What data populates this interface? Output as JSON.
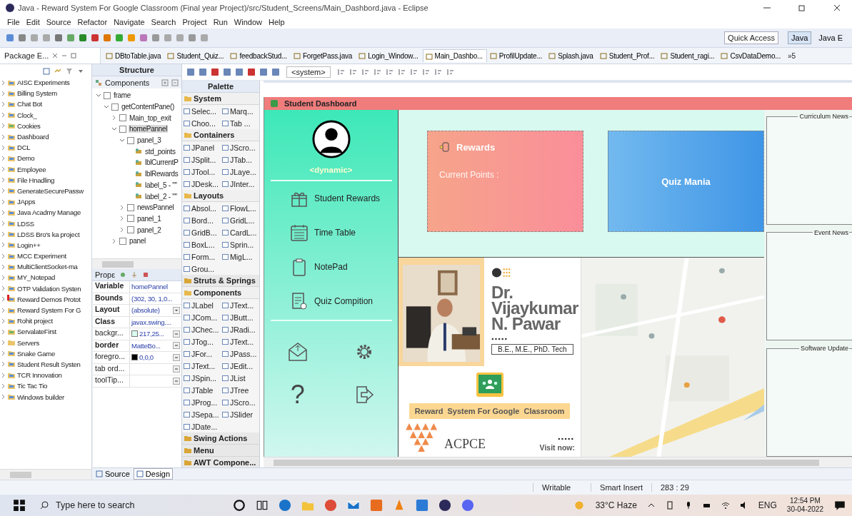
{
  "window": {
    "title": "Java - Reward System For Google Classroom (Final year Project)/src/Student_Screens/Main_Dashbord.java - Eclipse"
  },
  "menu": [
    "File",
    "Edit",
    "Source",
    "Refactor",
    "Navigate",
    "Search",
    "Project",
    "Run",
    "Window",
    "Help"
  ],
  "toolbar": {
    "quick_access": "Quick Access",
    "perspectives": [
      {
        "label": "Java",
        "selected": true
      },
      {
        "label": "Java E",
        "selected": false
      }
    ]
  },
  "package_explorer": {
    "tab": "Package E...",
    "items": [
      {
        "name": "AISC Experiments",
        "kind": "project"
      },
      {
        "name": "Billing System",
        "kind": "project"
      },
      {
        "name": "Chat Bot",
        "kind": "project"
      },
      {
        "name": "Clock_",
        "kind": "project"
      },
      {
        "name": "Cookies",
        "kind": "web"
      },
      {
        "name": "Dashboard",
        "kind": "project"
      },
      {
        "name": "DCL",
        "kind": "project"
      },
      {
        "name": "Demo",
        "kind": "project"
      },
      {
        "name": "Employee",
        "kind": "project"
      },
      {
        "name": "File Hnadling",
        "kind": "project"
      },
      {
        "name": "GenerateSecurePassw",
        "kind": "project"
      },
      {
        "name": "JApps",
        "kind": "project"
      },
      {
        "name": "Java Acadmy Manage",
        "kind": "project"
      },
      {
        "name": "LDSS",
        "kind": "project"
      },
      {
        "name": "LDSS Bro's ka project",
        "kind": "project"
      },
      {
        "name": "Login++",
        "kind": "project"
      },
      {
        "name": "MCC Experiment",
        "kind": "project"
      },
      {
        "name": "MultiClientSocket-ma",
        "kind": "project"
      },
      {
        "name": "MY_Notepad",
        "kind": "project"
      },
      {
        "name": "OTP Validation Systen",
        "kind": "project"
      },
      {
        "name": "Reward Demos Protot",
        "kind": "error"
      },
      {
        "name": "Reward System For G",
        "kind": "project"
      },
      {
        "name": "Rohit project",
        "kind": "project"
      },
      {
        "name": "ServalateFirst",
        "kind": "web"
      },
      {
        "name": "Servers",
        "kind": "folder"
      },
      {
        "name": "Snake Game",
        "kind": "project"
      },
      {
        "name": "Student Result Systen",
        "kind": "project"
      },
      {
        "name": "TCR Innovation",
        "kind": "project"
      },
      {
        "name": "Tic Tac Tio",
        "kind": "project"
      },
      {
        "name": "Windows builder",
        "kind": "project"
      }
    ]
  },
  "editor_tabs": [
    {
      "label": "DBtoTable.java",
      "selected": false
    },
    {
      "label": "Student_Quiz...",
      "selected": false
    },
    {
      "label": "feedbackStud...",
      "selected": false
    },
    {
      "label": "ForgetPass.java",
      "selected": false
    },
    {
      "label": "Login_Window...",
      "selected": false
    },
    {
      "label": "Main_Dashbo...",
      "selected": true
    },
    {
      "label": "ProfilUpdate...",
      "selected": false
    },
    {
      "label": "Splash.java",
      "selected": false
    },
    {
      "label": "Student_Prof...",
      "selected": false
    },
    {
      "label": "Student_ragi...",
      "selected": false
    },
    {
      "label": "CsvDataDemo...",
      "selected": false
    }
  ],
  "editor_tabs_overflow": "»5",
  "structure": {
    "title": "Structure",
    "components_label": "Components",
    "tree": [
      {
        "label": "frame",
        "kind": "container",
        "expanded": true,
        "selected": false,
        "children": [
          {
            "label": "getContentPane()",
            "kind": "container",
            "expanded": true,
            "selected": false,
            "children": [
              {
                "label": "Main_top_exit",
                "kind": "container",
                "expanded": false,
                "selected": false
              },
              {
                "label": "homePannel",
                "kind": "container",
                "expanded": true,
                "selected": true,
                "children": [
                  {
                    "label": "panel_3",
                    "kind": "container",
                    "expanded": true,
                    "selected": false,
                    "children": [
                      {
                        "label": "std_points",
                        "kind": "label",
                        "selected": false
                      },
                      {
                        "label": "lblCurrentP",
                        "kind": "label",
                        "selected": false
                      },
                      {
                        "label": "lblRewards",
                        "kind": "label",
                        "selected": false
                      },
                      {
                        "label": "label_5 - \"\"",
                        "kind": "label",
                        "selected": false
                      },
                      {
                        "label": "label_2 - \"\"",
                        "kind": "label",
                        "selected": false
                      }
                    ]
                  },
                  {
                    "label": "newsPannel",
                    "kind": "container",
                    "expanded": false,
                    "selected": false
                  },
                  {
                    "label": "panel_1",
                    "kind": "container",
                    "expanded": false,
                    "selected": false
                  },
                  {
                    "label": "panel_2",
                    "kind": "container",
                    "expanded": false,
                    "selected": false
                  }
                ]
              },
              {
                "label": "panel",
                "kind": "container",
                "expanded": false,
                "selected": false
              }
            ]
          }
        ]
      }
    ]
  },
  "properties": {
    "title": "Propε",
    "rows": [
      {
        "name": "Variable",
        "value": "homePannel",
        "bold": true,
        "kind": "plain"
      },
      {
        "name": "Bounds",
        "value": "(302, 30, 1,0...",
        "bold": true,
        "kind": "expand"
      },
      {
        "name": "Layout",
        "value": "(absolute)",
        "bold": true,
        "kind": "dropdown"
      },
      {
        "name": "Class",
        "value": "javax.swing....",
        "bold": true,
        "kind": "plain"
      },
      {
        "name": "backgr...",
        "value": "217,25...",
        "bold": false,
        "kind": "button",
        "color": "#d9fbf0"
      },
      {
        "name": "border",
        "value": "MatteBo...",
        "bold": true,
        "kind": "button"
      },
      {
        "name": "foregro...",
        "value": "0,0,0",
        "bold": false,
        "kind": "button",
        "color": "#000000"
      },
      {
        "name": "tab ord...",
        "bold": false,
        "kind": "button"
      },
      {
        "name": "toolTip...",
        "bold": false,
        "kind": "button"
      }
    ]
  },
  "editor_toolbar": {
    "system": "<system>"
  },
  "palette": {
    "title": "Palette",
    "groups": [
      {
        "name": "System",
        "expanded": true,
        "items": [
          "Selec...",
          "Marq...",
          "Choo...",
          "Tab ..."
        ]
      },
      {
        "name": "Containers",
        "expanded": true,
        "items": [
          "JPanel",
          "JScro...",
          "JSplit...",
          "JTab...",
          "JTool...",
          "JLaye...",
          "JDesk...",
          "JInter..."
        ]
      },
      {
        "name": "Layouts",
        "expanded": true,
        "items": [
          "Absol...",
          "FlowL...",
          "Bord...",
          "GridL...",
          "GridB...",
          "CardL...",
          "BoxL...",
          "Sprin...",
          "Form...",
          "MigL...",
          "Grou..."
        ]
      },
      {
        "name": "Struts & Springs",
        "expanded": false
      },
      {
        "name": "Components",
        "expanded": true,
        "items": [
          "JLabel",
          "JText...",
          "JCom...",
          "JButt...",
          "JChec...",
          "JRadi...",
          "JTog...",
          "JText...",
          "JFor...",
          "JPass...",
          "JText...",
          "JEdit...",
          "JSpin...",
          "JList",
          "JTable",
          "JTree",
          "JProg...",
          "JScro...",
          "JSepa...",
          "JSlider",
          "JDate..."
        ]
      },
      {
        "name": "Swing Actions",
        "expanded": false
      },
      {
        "name": "Menu",
        "expanded": false
      },
      {
        "name": "AWT Compone...",
        "expanded": false
      }
    ]
  },
  "dashboard": {
    "title": "Student Dashboard",
    "user": "<dynamic>",
    "nav": [
      {
        "label": "Student Rewards",
        "kind": "gift"
      },
      {
        "label": "Time Table",
        "kind": "calendar"
      },
      {
        "label": "NotePad",
        "kind": "clipboard"
      },
      {
        "label": "Quiz Compition",
        "kind": "quiz"
      }
    ],
    "actions": [
      {
        "kind": "mail"
      },
      {
        "kind": "settings"
      },
      {
        "kind": "help",
        "glyph": "?"
      },
      {
        "kind": "exit"
      }
    ],
    "cards": [
      {
        "title": "Rewards",
        "subtitle": "Current Points :",
        "kind": "rewards"
      },
      {
        "title": "Quiz Mania",
        "kind": "quiz"
      }
    ],
    "banner": {
      "name": "Dr. Vijaykumar N. Pawar",
      "degree": "B.E., M.E., PhD. Tech",
      "caption": "Reward  System For Google  Classroom",
      "logo": "ACPCE",
      "visit": "Visit now:"
    },
    "news": [
      "Curriculum News",
      "Event News",
      "Software Update"
    ]
  },
  "bottom_tabs": [
    {
      "label": "Source",
      "selected": false
    },
    {
      "label": "Design",
      "selected": true
    }
  ],
  "status": [
    "Writable",
    "Smart Insert",
    "283 : 29"
  ],
  "taskbar": {
    "search": "Type here to search",
    "weather": "33°C  Haze",
    "lang": "ENG",
    "time": "12:54 PM",
    "date": "30-04-2022"
  }
}
